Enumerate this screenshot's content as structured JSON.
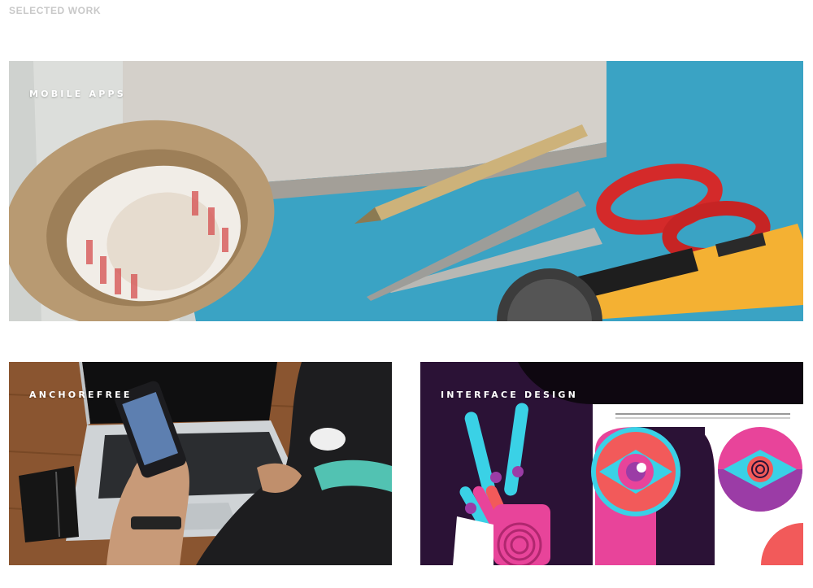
{
  "section": {
    "title": "SELECTED WORK"
  },
  "projects": [
    {
      "label": "MOBILE APPS",
      "image": "tape-scissors-craft-tools-photo"
    },
    {
      "label": "ANCHOREFREE",
      "image": "phone-laptop-desk-photo"
    },
    {
      "label": "INTERFACE DESIGN",
      "image": "abstract-eye-hand-illustration"
    }
  ],
  "colors": {
    "title_gray": "#c8c8c8",
    "teal": "#3aa3c4",
    "tape_kraft": "#b89a72",
    "scissor_red": "#d42a2a",
    "cutter_yellow": "#f4b133",
    "wood": "#8a5530",
    "illus_purple": "#2b1236",
    "illus_pink": "#e8449a",
    "illus_cyan": "#3ad1e6",
    "illus_coral": "#f25a5a"
  }
}
